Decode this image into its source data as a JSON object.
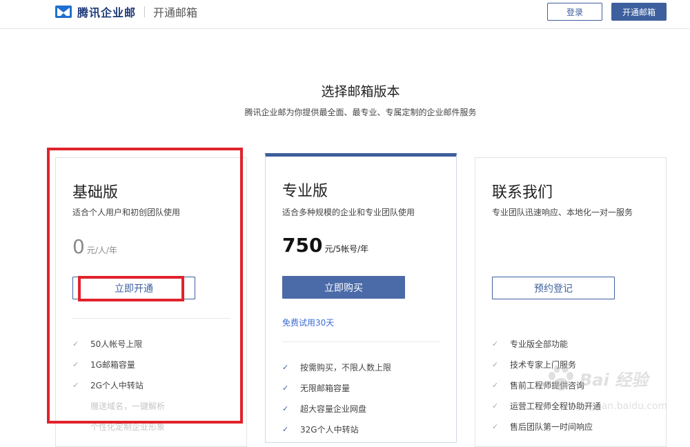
{
  "header": {
    "brand": "腾讯企业邮",
    "section": "开通邮箱",
    "login_label": "登录",
    "open_label": "开通邮箱"
  },
  "intro": {
    "title": "选择邮箱版本",
    "subtitle": "腾讯企业邮为你提供最全面、最专业、专属定制的企业邮件服务"
  },
  "plans": [
    {
      "name": "基础版",
      "desc": "适合个人用户和初创团队使用",
      "price": "0",
      "unit": "元/人/年",
      "cta": "立即开通",
      "features": [
        "50人帐号上限",
        "1G邮箱容量",
        "2G个人中转站"
      ],
      "faded_features": [
        "赠送域名，一键解析",
        "个性化定制企业形象"
      ]
    },
    {
      "name": "专业版",
      "desc": "适合多种规模的企业和专业团队使用",
      "price": "750",
      "unit": "元/5帐号/年",
      "cta": "立即购买",
      "trial": "免费试用30天",
      "features": [
        "按需购买，不限人数上限",
        "无限邮箱容量",
        "超大容量企业网盘",
        "32G个人中转站"
      ]
    },
    {
      "name": "联系我们",
      "desc": "专业团队迅速响应、本地化一对一服务",
      "cta": "预约登记",
      "features": [
        "专业版全部功能",
        "技术专家上门服务",
        "售前工程师提供咨询",
        "运营工程师全程协助开通",
        "售后团队第一时间响应"
      ]
    }
  ],
  "watermark": {
    "top": "Bai 经验",
    "bottom": "jingyan.baidu.com"
  },
  "colors": {
    "accent": "#3d5f9d",
    "annotation": "#e0222b",
    "link": "#3d6bd6"
  }
}
